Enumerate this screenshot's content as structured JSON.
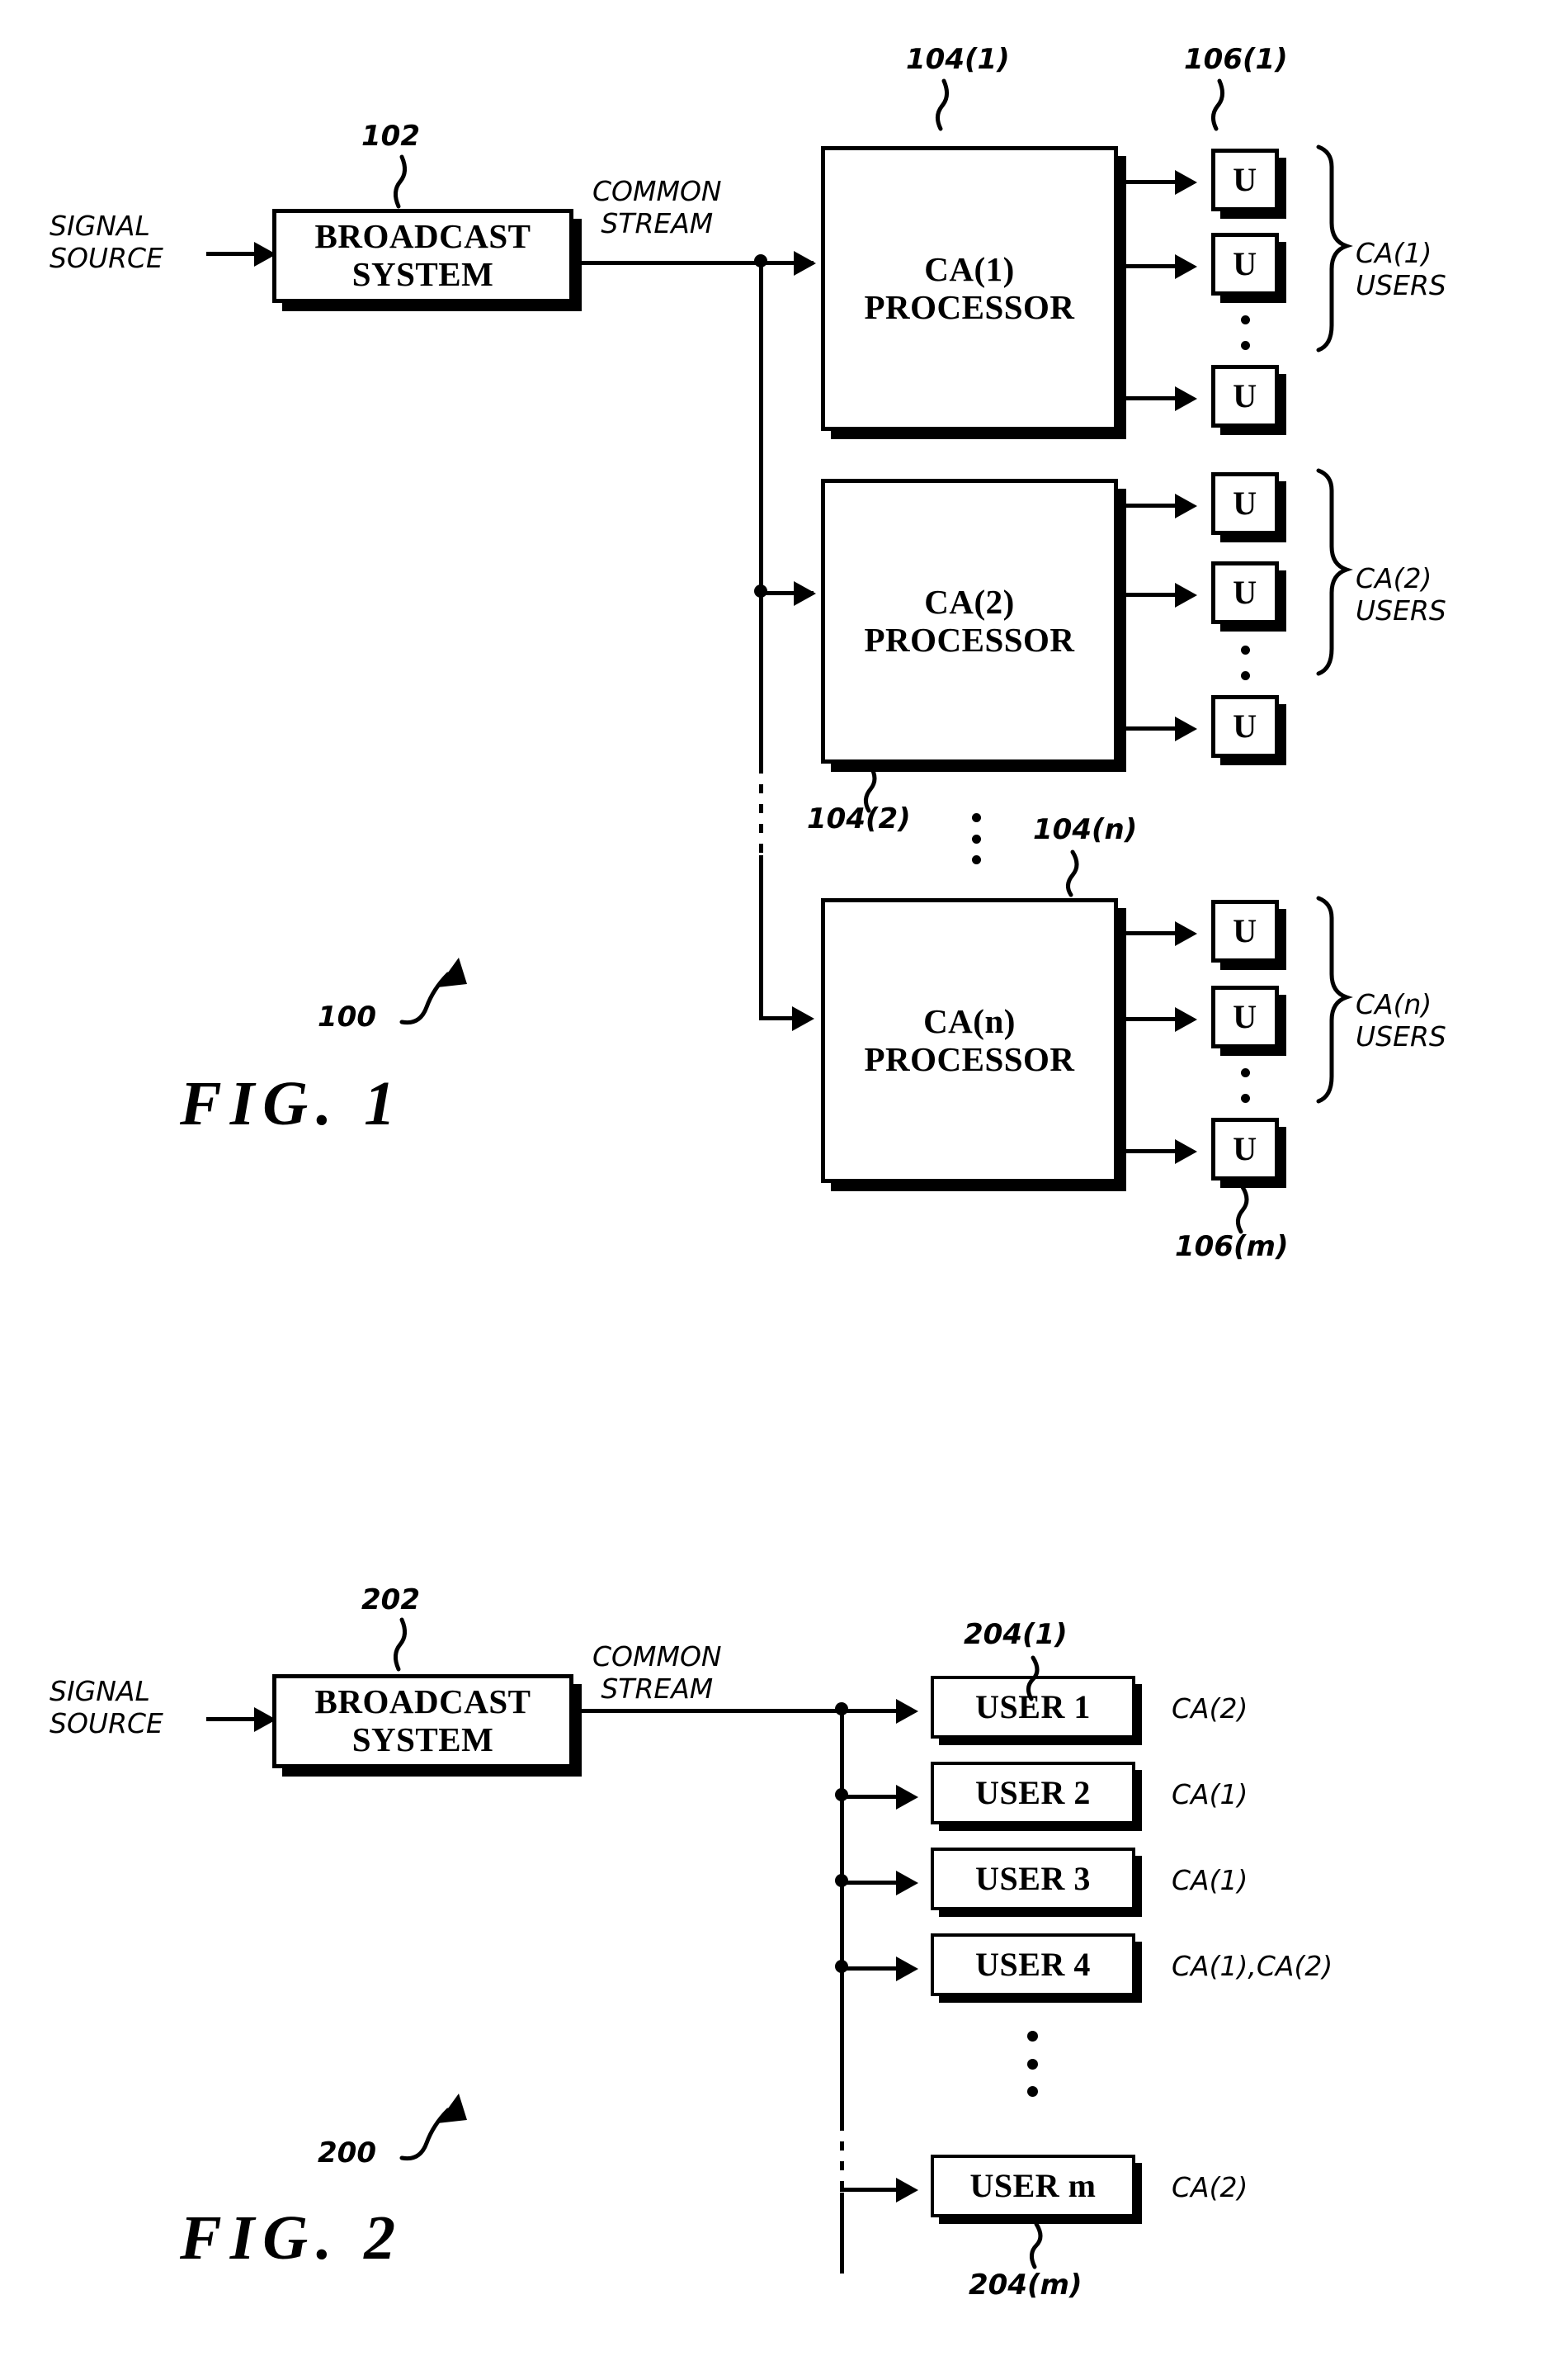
{
  "document": {
    "type": "patent-drawing-sheet",
    "figures": [
      "FIG. 1",
      "FIG. 2"
    ]
  },
  "figure1": {
    "caption": "FIG. 1",
    "system_ref": "100",
    "signal_source_label": "SIGNAL\nSOURCE",
    "signal_source_line1": "SIGNAL",
    "signal_source_line2": "SOURCE",
    "broadcast_system": {
      "label_line1": "BROADCAST",
      "label_line2": "SYSTEM",
      "ref": "102"
    },
    "common_stream_line1": "COMMON",
    "common_stream_line2": "STREAM",
    "processors": [
      {
        "label_line1": "CA(1)",
        "label_line2": "PROCESSOR",
        "ref": "104(1)",
        "users_brace_line1": "CA(1)",
        "users_brace_line2": "USERS",
        "user_box_label": "U",
        "user_ref": "106(1)",
        "user_count_shown": 3
      },
      {
        "label_line1": "CA(2)",
        "label_line2": "PROCESSOR",
        "ref": "104(2)",
        "users_brace_line1": "CA(2)",
        "users_brace_line2": "USERS",
        "user_box_label": "U",
        "user_count_shown": 3
      },
      {
        "label_line1": "CA(n)",
        "label_line2": "PROCESSOR",
        "ref": "104(n)",
        "users_brace_line1": "CA(n)",
        "users_brace_line2": "USERS",
        "user_box_label": "U",
        "user_ref": "106(m)",
        "user_count_shown": 3
      }
    ]
  },
  "figure2": {
    "caption": "FIG. 2",
    "system_ref": "200",
    "signal_source_line1": "SIGNAL",
    "signal_source_line2": "SOURCE",
    "broadcast_system": {
      "label_line1": "BROADCAST",
      "label_line2": "SYSTEM",
      "ref": "202"
    },
    "common_stream_line1": "COMMON",
    "common_stream_line2": "STREAM",
    "first_user_ref": "204(1)",
    "last_user_ref": "204(m)",
    "users": [
      {
        "label": "USER 1",
        "ca": "CA(2)"
      },
      {
        "label": "USER 2",
        "ca": "CA(1)"
      },
      {
        "label": "USER 3",
        "ca": "CA(1)"
      },
      {
        "label": "USER 4",
        "ca": "CA(1),CA(2)"
      },
      {
        "label": "USER m",
        "ca": "CA(2)"
      }
    ]
  },
  "colors": {
    "ink": "#000000",
    "paper": "#ffffff"
  }
}
